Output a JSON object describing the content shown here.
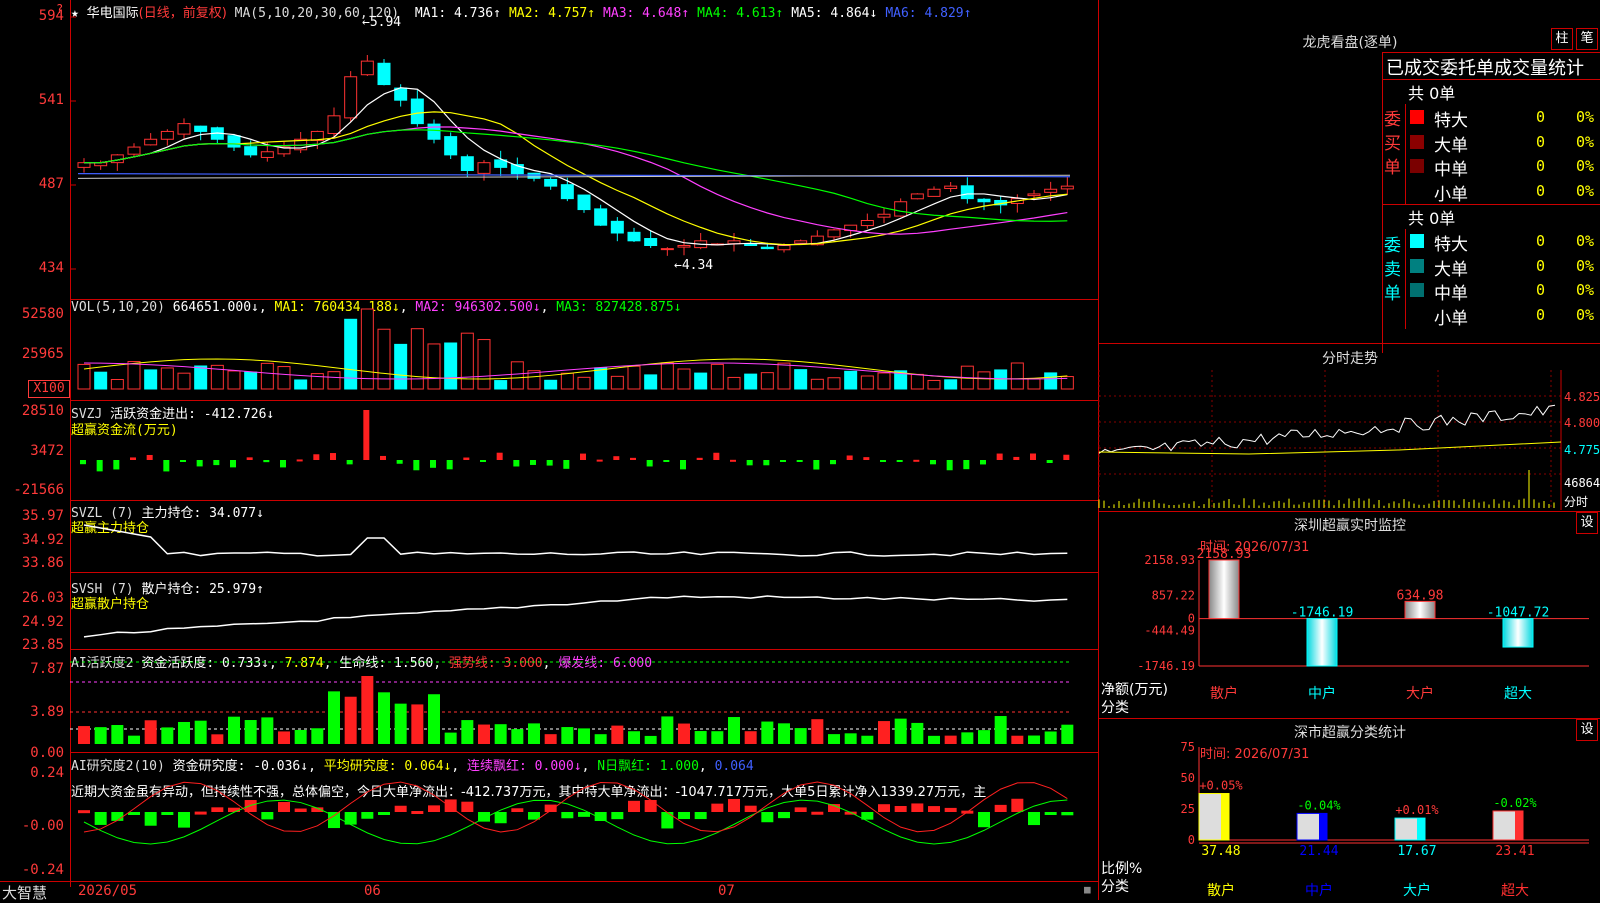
{
  "main": {
    "stock_name": "华电国际",
    "mode": "(日线，前复权)",
    "ma_header": "MA(5,10,20,30,60,120)",
    "mas": [
      {
        "label": "MA1: 4.736↑",
        "color": "#ffffff"
      },
      {
        "label": "MA2: 4.757↑",
        "color": "#ffff00"
      },
      {
        "label": "MA3: 4.648↑",
        "color": "#ff40ff"
      },
      {
        "label": "MA4: 4.613↑",
        "color": "#00ff00"
      },
      {
        "label": "MA5: 4.864↓",
        "color": "#ffffff"
      },
      {
        "label": "MA6: 4.829↑",
        "color": "#4060ff"
      }
    ],
    "y_ticks": [
      "594",
      "541",
      "487",
      "434"
    ],
    "high_marker": "5.94",
    "low_marker": "4.34",
    "colors": {
      "up": "#ff3232",
      "down": "#00ffff",
      "ma5": "#ffffff",
      "ma10": "#ffff00",
      "ma20": "#ff40ff",
      "ma30": "#00ff00",
      "ma60": "#ffffff",
      "ma120": "#4060ff"
    }
  },
  "vol": {
    "title": "VOL(5,10,20)",
    "value": "664651.000↓",
    "ma1": "MA1: 760434.188↓",
    "ma2": "MA2: 946302.500↓",
    "ma3": "MA3: 827428.875↓",
    "y_ticks": [
      "52580",
      "25965"
    ],
    "unit": "X100"
  },
  "svzj": {
    "title": "SVZJ",
    "label": "活跃资金进出: -412.726↓",
    "sub": "超赢资金流(万元)",
    "y_ticks": [
      "28510",
      "3472",
      "-21566"
    ]
  },
  "svzl": {
    "title": "SVZL (7)",
    "label": "主力持仓: 34.077↓",
    "sub": "超赢主力持仓",
    "y_ticks": [
      "35.97",
      "34.92",
      "33.86"
    ]
  },
  "svsh": {
    "title": "SVSH (7)",
    "label": "散户持仓: 25.979↑",
    "sub": "超赢散户持仓",
    "y_ticks": [
      "26.03",
      "24.92",
      "23.85"
    ]
  },
  "ai1": {
    "title": "AI活跃度2",
    "label": "资金活跃度: 0.733↓",
    "v2": "7.874",
    "life": "生命线: 1.560",
    "strong": "强势线: 3.000",
    "burst": "爆发线: 6.000",
    "y_ticks": [
      "7.87",
      "3.89",
      "0.00"
    ]
  },
  "ai2": {
    "title": "AI研究度2(10)",
    "label": "资金研究度: -0.036↓",
    "avg": "平均研究度: 0.064↓",
    "streak": "连续飘红: 0.000↓",
    "n_red": "N日飘红: 1.000",
    "extra": "0.064",
    "comment": "近期大资金虽有异动，但持续性不强，总体偏空，今日大单净流出：-412.737万元，其中特大单净流出：-1047.717万元，大单5日累计净入1339.27万元，主",
    "y_ticks": [
      "0.24",
      "-0.00",
      "-0.24"
    ]
  },
  "xaxis": {
    "brand": "大智慧",
    "labels": [
      "2026/05",
      "06",
      "07"
    ]
  },
  "dragon": {
    "title": "龙虎看盘(逐单)",
    "btn1": "柱",
    "btn2": "笔",
    "sub": "已成交委托单成交量统计",
    "buy_total": "共 0单",
    "buy_label": "委买单",
    "sell_total": "共 0单",
    "sell_label": "委卖单",
    "buy_rows": [
      {
        "name": "特大",
        "count": "0",
        "pct": "0%",
        "color": "#ff0000"
      },
      {
        "name": "大单",
        "count": "0",
        "pct": "0%",
        "color": "#8b0000"
      },
      {
        "name": "中单",
        "count": "0",
        "pct": "0%",
        "color": "#7a0000"
      },
      {
        "name": "小单",
        "count": "0",
        "pct": "0%",
        "color": "#000000"
      }
    ],
    "sell_rows": [
      {
        "name": "特大",
        "count": "0",
        "pct": "0%",
        "color": "#00ffff"
      },
      {
        "name": "大单",
        "count": "0",
        "pct": "0%",
        "color": "#008080"
      },
      {
        "name": "中单",
        "count": "0",
        "pct": "0%",
        "color": "#007070"
      },
      {
        "name": "小单",
        "count": "0",
        "pct": "0%",
        "color": "#000000"
      }
    ]
  },
  "intraday": {
    "title": "分时走势",
    "prices": [
      "4.825",
      "4.800",
      "4.775"
    ],
    "vol": "46864",
    "vol_label": "分时"
  },
  "monitor": {
    "title": "深圳超赢实时监控",
    "btn": "设",
    "time": "时间: 2026/07/31",
    "y_ticks": [
      "2158.93",
      "857.22",
      "0",
      "-444.49",
      "-1746.19"
    ],
    "y_name": "净额(万元)",
    "x_name": "分类",
    "bars": [
      {
        "name": "散户",
        "value": 2158.93,
        "label": "2158.93"
      },
      {
        "name": "中户",
        "value": -1746.19,
        "label": "-1746.19"
      },
      {
        "name": "大户",
        "value": 634.98,
        "label": "634.98"
      },
      {
        "name": "超大",
        "value": -1047.72,
        "label": "-1047.72"
      }
    ]
  },
  "stats": {
    "title": "深市超赢分类统计",
    "btn": "设",
    "time": "时间: 2026/07/31",
    "y_ticks": [
      "75",
      "50",
      "25",
      "0"
    ],
    "y_name": "比例%",
    "x_name": "分类",
    "bars": [
      {
        "name": "散户",
        "value": 37.48,
        "label": "37.48",
        "chg": "+0.05%",
        "color": "#ffff00"
      },
      {
        "name": "中户",
        "value": 21.44,
        "label": "21.44",
        "chg": "-0.04%",
        "color": "#0000ff"
      },
      {
        "name": "大户",
        "value": 17.67,
        "label": "17.67",
        "chg": "+0.01%",
        "color": "#00ffff"
      },
      {
        "name": "超大",
        "value": 23.41,
        "label": "23.41",
        "chg": "-0.02%",
        "color": "#ff3030"
      }
    ]
  }
}
